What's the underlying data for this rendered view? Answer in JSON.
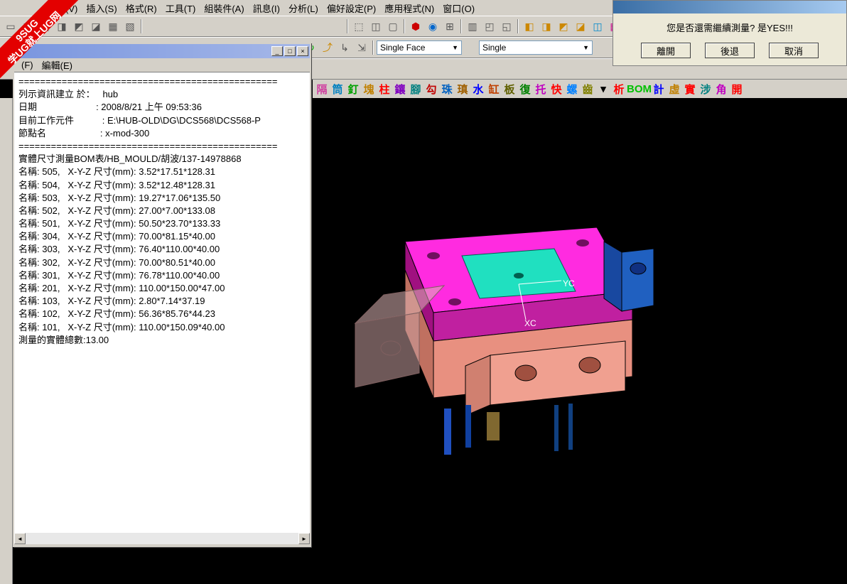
{
  "menubar": {
    "items": [
      "視圖(V)",
      "插入(S)",
      "格式(R)",
      "工具(T)",
      "組裝件(A)",
      "訊息(I)",
      "分析(L)",
      "偏好設定(P)",
      "應用程式(N)",
      "窗口(O)"
    ]
  },
  "toolbar2": {
    "dropdown1": "Single Face",
    "dropdown2": "Single"
  },
  "colored_chars": [
    {
      "t": "隔",
      "c": "#d040a0"
    },
    {
      "t": "筒",
      "c": "#0080c0"
    },
    {
      "t": "釘",
      "c": "#00a000"
    },
    {
      "t": "塊",
      "c": "#c08000"
    },
    {
      "t": "柱",
      "c": "#ff0000"
    },
    {
      "t": "鑲",
      "c": "#8000c0"
    },
    {
      "t": "腳",
      "c": "#008080"
    },
    {
      "t": "勾",
      "c": "#c00000"
    },
    {
      "t": "珠",
      "c": "#0060c0"
    },
    {
      "t": "瑱",
      "c": "#a06000"
    },
    {
      "t": "水",
      "c": "#0000ff"
    },
    {
      "t": "缸",
      "c": "#c04000"
    },
    {
      "t": "板",
      "c": "#606000"
    },
    {
      "t": "復",
      "c": "#008000"
    },
    {
      "t": "托",
      "c": "#c000c0"
    },
    {
      "t": "快",
      "c": "#ff0000"
    },
    {
      "t": "螺",
      "c": "#0080ff"
    },
    {
      "t": "齒",
      "c": "#808000"
    },
    {
      "t": "▾",
      "c": "#000"
    },
    {
      "t": "析",
      "c": "#ff0000"
    },
    {
      "t": "BOM",
      "c": "#00c000"
    },
    {
      "t": "計",
      "c": "#0000ff"
    },
    {
      "t": "虛",
      "c": "#c08000"
    },
    {
      "t": "實",
      "c": "#ff0000"
    },
    {
      "t": "涉",
      "c": "#008080"
    },
    {
      "t": "角",
      "c": "#c000c0"
    },
    {
      "t": "開",
      "c": "#ff0000"
    }
  ],
  "info_window": {
    "menu": [
      "(F)",
      "編輯(E)"
    ],
    "header": [
      "================================================",
      "列示資訊建立 於：   hub",
      "日期                       : 2008/8/21 上午 09:53:36",
      "目前工作元件           : E:\\HUB-OLD\\DG\\DCS568\\DCS568-P",
      "節點名                     : x-mod-300",
      "================================================",
      "實體尺寸測量BOM表/HB_MOULD/胡波/137-14978868"
    ],
    "rows": [
      {
        "name": "505",
        "dims": "3.52*17.51*128.31"
      },
      {
        "name": "504",
        "dims": "3.52*12.48*128.31"
      },
      {
        "name": "503",
        "dims": "19.27*17.06*135.50"
      },
      {
        "name": "502",
        "dims": "27.00*7.00*133.08"
      },
      {
        "name": "501",
        "dims": "50.50*23.70*133.33"
      },
      {
        "name": "304",
        "dims": "70.00*81.15*40.00"
      },
      {
        "name": "303",
        "dims": "76.40*110.00*40.00"
      },
      {
        "name": "302",
        "dims": "70.00*80.51*40.00"
      },
      {
        "name": "301",
        "dims": "76.78*110.00*40.00"
      },
      {
        "name": "201",
        "dims": "110.00*150.00*47.00"
      },
      {
        "name": "103",
        "dims": "2.80*7.14*37.19"
      },
      {
        "name": "102",
        "dims": "56.36*85.76*44.23"
      },
      {
        "name": "101",
        "dims": "110.00*150.09*40.00"
      }
    ],
    "footer": "測量的實體總數:13.00",
    "row_prefix": "名稱: ",
    "row_mid": ",   X-Y-Z 尺寸(mm): "
  },
  "dialog": {
    "message": "您是否還需繼續測量? 是YES!!!",
    "buttons": [
      "離開",
      "後退",
      "取消"
    ]
  },
  "ribbon": {
    "line1": "9SUG",
    "line2": "学UG就上UG网"
  },
  "axes": {
    "y": "YC",
    "x": "XC"
  }
}
